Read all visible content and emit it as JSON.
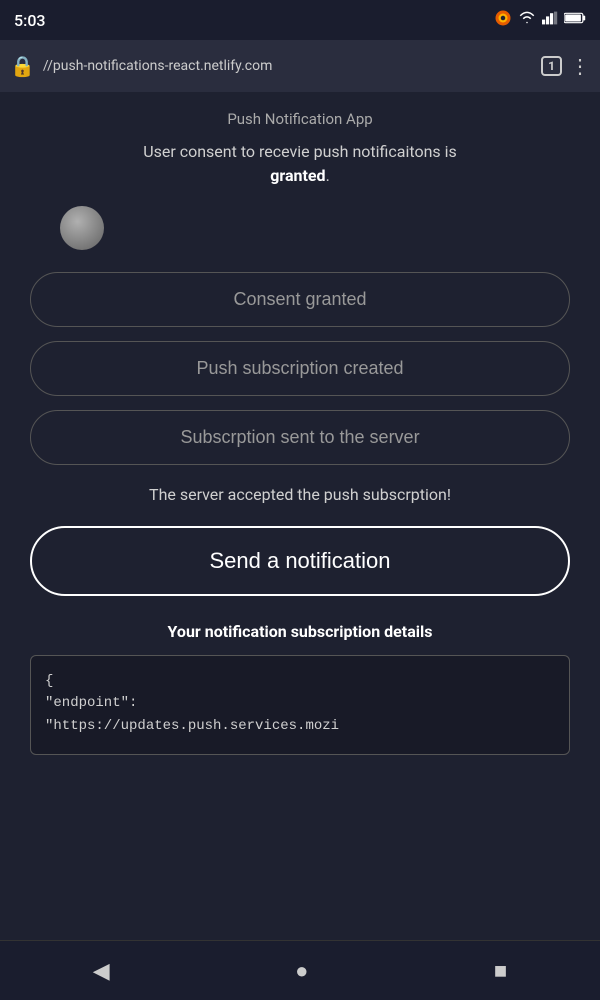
{
  "statusBar": {
    "time": "5:03",
    "firefoxIcon": "🦊"
  },
  "browserBar": {
    "url": "//push-notifications-react.netlify.com",
    "tabCount": "1"
  },
  "page": {
    "titleHint": "Push Notification App",
    "consentText": "User consent to recevie push notificaitons is",
    "consentStrong": "granted",
    "consentPeriod": ".",
    "btn1": "Consent granted",
    "btn2": "Push subscription created",
    "btn3": "Subscrption sent to the server",
    "serverAccepted": "The server accepted the push subscrption!",
    "sendBtnLabel": "Send a notification",
    "subDetailsTitle": "Your notification subscription details",
    "jsonLine1": "{",
    "jsonLine2": "  \"endpoint\":",
    "jsonLine3": "\"https://updates.push.services.mozi"
  },
  "navBar": {
    "backIcon": "◀",
    "homeIcon": "●",
    "recentIcon": "■"
  }
}
